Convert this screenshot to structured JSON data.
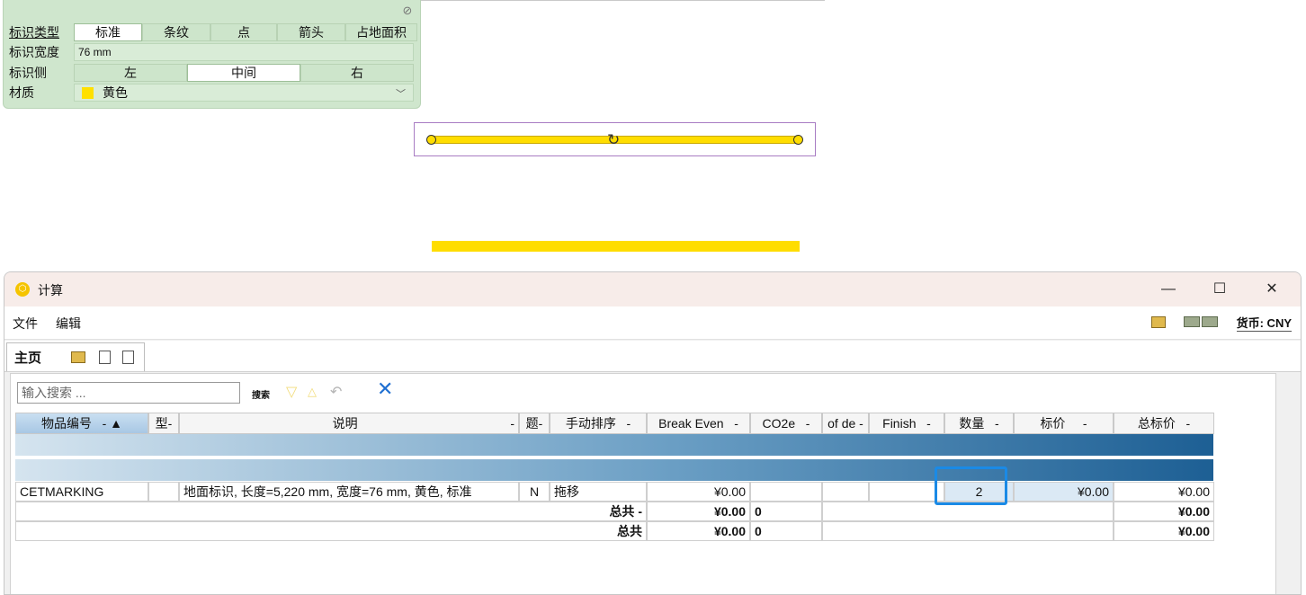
{
  "props": {
    "rows": [
      {
        "label": "标识类型",
        "options": [
          "标准",
          "条纹",
          "点",
          "箭头",
          "占地面积"
        ],
        "selected": "标准"
      },
      {
        "label": "标识宽度",
        "value": "76 mm"
      },
      {
        "label": "标识侧",
        "options": [
          "左",
          "中间",
          "右"
        ],
        "selected": "中间"
      },
      {
        "label": "材质",
        "value": "黄色",
        "swatch_color": "#ffe000"
      }
    ]
  },
  "window": {
    "title": "计算",
    "controls": {
      "minimize": "—",
      "maximize": "☐",
      "close": "✕"
    },
    "menu": [
      "文件",
      "编辑"
    ],
    "currency": "货币: CNY",
    "tab": "主页",
    "search_placeholder": "输入搜索 ...",
    "search_label": "搜索",
    "columns": [
      {
        "label": "物品编号",
        "suffix": "- ▲"
      },
      {
        "label": "型",
        "suffix": "-"
      },
      {
        "label": "说明",
        "suffix": "-"
      },
      {
        "label": "题",
        "suffix": "-"
      },
      {
        "label": "手动排序",
        "suffix": "-"
      },
      {
        "label": "Break Even",
        "suffix": "-"
      },
      {
        "label": "CO2e",
        "suffix": "-"
      },
      {
        "label": "of de",
        "suffix": "-"
      },
      {
        "label": "Finish",
        "suffix": "-"
      },
      {
        "label": "数量",
        "suffix": "-"
      },
      {
        "label": "标价",
        "suffix": "-"
      },
      {
        "label": "总标价",
        "suffix": "-"
      }
    ],
    "row": {
      "item": "CETMARKING",
      "desc": "地面标识, 长度=5,220 mm, 宽度=76 mm, 黄色, 标准",
      "flag": "N",
      "sort": "拖移",
      "break_even": "¥0.00",
      "qty": "2",
      "price": "¥0.00",
      "total": "¥0.00"
    },
    "subtotal": {
      "label": "总共 -",
      "break_even": "¥0.00",
      "co2e": "0",
      "total": "¥0.00"
    },
    "grandtotal": {
      "label": "总共",
      "break_even": "¥0.00",
      "co2e": "0",
      "total": "¥0.00"
    }
  }
}
